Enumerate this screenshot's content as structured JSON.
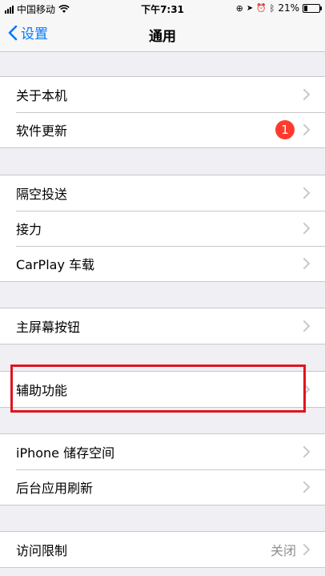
{
  "status_bar": {
    "carrier": "中国移动",
    "time": "下午7:31",
    "battery_percent": "21%",
    "battery_level": 0.21
  },
  "nav": {
    "back_label": "设置",
    "title": "通用"
  },
  "groups": [
    {
      "items": [
        {
          "label": "关于本机"
        },
        {
          "label": "软件更新",
          "badge": "1"
        }
      ]
    },
    {
      "items": [
        {
          "label": "隔空投送"
        },
        {
          "label": "接力"
        },
        {
          "label": "CarPlay 车载"
        }
      ]
    },
    {
      "items": [
        {
          "label": "主屏幕按钮"
        }
      ]
    },
    {
      "items": [
        {
          "label": "辅助功能"
        }
      ]
    },
    {
      "items": [
        {
          "label": "iPhone 储存空间"
        },
        {
          "label": "后台应用刷新"
        }
      ]
    },
    {
      "items": [
        {
          "label": "访问限制",
          "value": "关闭"
        }
      ]
    }
  ],
  "colors": {
    "accent": "#007aff",
    "badge": "#ff3b30",
    "highlight": "#e0141e",
    "background": "#efeff4"
  }
}
